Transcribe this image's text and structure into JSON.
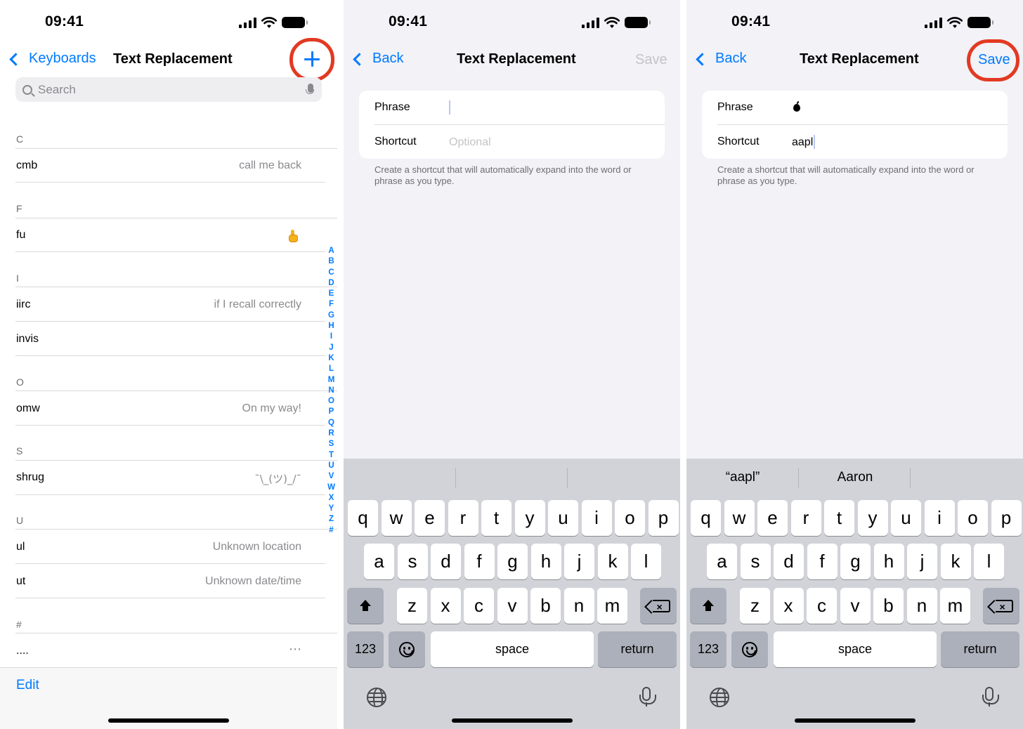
{
  "status": {
    "time": "09:41"
  },
  "screen1": {
    "back_label": "Keyboards",
    "title": "Text Replacement",
    "search_placeholder": "Search",
    "sections": [
      {
        "header": "C",
        "rows": [
          {
            "shortcut": "cmb",
            "phrase": "call me back"
          }
        ]
      },
      {
        "header": "F",
        "rows": [
          {
            "shortcut": "fu",
            "phrase": "",
            "phrase_icon": "middle-finger-emoji"
          }
        ]
      },
      {
        "header": "I",
        "rows": [
          {
            "shortcut": "iirc",
            "phrase": "if I recall correctly"
          },
          {
            "shortcut": "invis",
            "phrase": ""
          }
        ]
      },
      {
        "header": "O",
        "rows": [
          {
            "shortcut": "omw",
            "phrase": "On my way!"
          }
        ]
      },
      {
        "header": "S",
        "rows": [
          {
            "shortcut": "shrug",
            "phrase": "¯\\_(ツ)_/¯"
          }
        ]
      },
      {
        "header": "U",
        "rows": [
          {
            "shortcut": "ul",
            "phrase": "Unknown location"
          },
          {
            "shortcut": "ut",
            "phrase": "Unknown date/time"
          }
        ]
      },
      {
        "header": "#",
        "rows": [
          {
            "shortcut": "....",
            "phrase": "⋯"
          }
        ]
      }
    ],
    "index_letters": [
      "A",
      "B",
      "C",
      "D",
      "E",
      "F",
      "G",
      "H",
      "I",
      "J",
      "K",
      "L",
      "M",
      "N",
      "O",
      "P",
      "Q",
      "R",
      "S",
      "T",
      "U",
      "V",
      "W",
      "X",
      "Y",
      "Z",
      "#"
    ],
    "edit_label": "Edit"
  },
  "screen2": {
    "back_label": "Back",
    "title": "Text Replacement",
    "save_label": "Save",
    "phrase_label": "Phrase",
    "phrase_value": "",
    "shortcut_label": "Shortcut",
    "shortcut_placeholder": "Optional",
    "footnote": "Create a shortcut that will automatically expand into the word or phrase as you type.",
    "suggestions": [
      "",
      "",
      ""
    ]
  },
  "screen3": {
    "back_label": "Back",
    "title": "Text Replacement",
    "save_label": "Save",
    "phrase_label": "Phrase",
    "phrase_icon": "apple-logo-icon",
    "shortcut_label": "Shortcut",
    "shortcut_value": "aapl",
    "footnote": "Create a shortcut that will automatically expand into the word or phrase as you type.",
    "suggestions": [
      "“aapl”",
      "Aaron",
      ""
    ]
  },
  "keyboard": {
    "row1": [
      "q",
      "w",
      "e",
      "r",
      "t",
      "y",
      "u",
      "i",
      "o",
      "p"
    ],
    "row2": [
      "a",
      "s",
      "d",
      "f",
      "g",
      "h",
      "j",
      "k",
      "l"
    ],
    "row3": [
      "z",
      "x",
      "c",
      "v",
      "b",
      "n",
      "m"
    ],
    "numbers_label": "123",
    "space_label": "space",
    "return_label": "return"
  },
  "colors": {
    "accent": "#007aff",
    "highlight_ring": "#e23a22",
    "disabled": "#c4c4c8"
  }
}
